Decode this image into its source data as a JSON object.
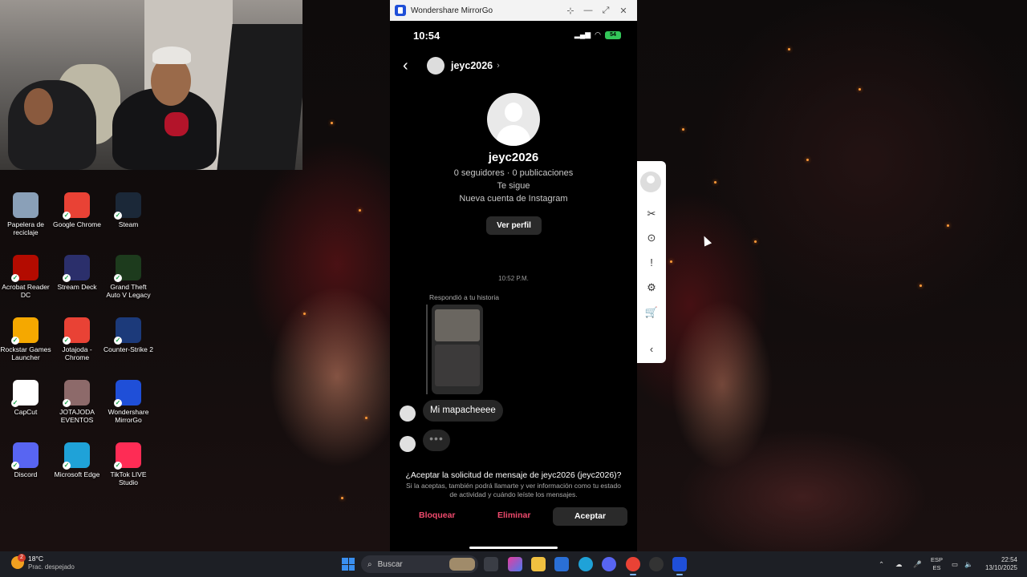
{
  "desktop": {
    "icons": [
      {
        "label": "Papelera de reciclaje",
        "icon": "recycle-bin-icon",
        "color": "#8aa0b8"
      },
      {
        "label": "Google Chrome",
        "icon": "chrome-icon",
        "color": "#e94235"
      },
      {
        "label": "Steam",
        "icon": "steam-icon",
        "color": "#1b2838"
      },
      {
        "label": "Acrobat Reader DC",
        "icon": "acrobat-icon",
        "color": "#b30b00"
      },
      {
        "label": "Stream Deck",
        "icon": "stream-deck-icon",
        "color": "#2b2f6b"
      },
      {
        "label": "Grand Theft Auto V Legacy",
        "icon": "gta-icon",
        "color": "#1d3b1d"
      },
      {
        "label": "Rockstar Games Launcher",
        "icon": "rockstar-icon",
        "color": "#f5a800"
      },
      {
        "label": "Jotajoda - Chrome",
        "icon": "chrome-icon",
        "color": "#e94235"
      },
      {
        "label": "Counter-Strike 2",
        "icon": "cs2-icon",
        "color": "#1c3a7a"
      },
      {
        "label": "CapCut",
        "icon": "capcut-icon",
        "color": "#ffffff"
      },
      {
        "label": "JOTAJODA EVENTOS",
        "icon": "folder-file-icon",
        "color": "#8d6a6a"
      },
      {
        "label": "Wondershare MirrorGo",
        "icon": "mirrorgo-icon",
        "color": "#1f4fd8"
      },
      {
        "label": "Discord",
        "icon": "discord-icon",
        "color": "#5865f2"
      },
      {
        "label": "Microsoft Edge",
        "icon": "edge-icon",
        "color": "#1fa2d8"
      },
      {
        "label": "TikTok LIVE Studio",
        "icon": "tiktok-icon",
        "color": "#fe2c55"
      }
    ]
  },
  "mirrorgo": {
    "title": "Wondershare MirrorGo",
    "window_buttons": {
      "pin": "⊹",
      "minimize": "—",
      "maximize": "⤢",
      "close": "✕"
    }
  },
  "phone": {
    "time": "10:54",
    "battery": "54",
    "header": {
      "back": "‹",
      "username": "jeyc2026",
      "chevron": "›"
    },
    "profile": {
      "name": "jeyc2026",
      "stats": "0 seguidores · 0 publicaciones",
      "follows_you": "Te sigue",
      "new_account": "Nueva cuenta de Instagram",
      "view_profile": "Ver perfil"
    },
    "chat": {
      "timestamp": "10:52 P.M.",
      "reply_label": "Respondió a tu historia",
      "message": "Mi mapacheeee",
      "typing": "•••"
    },
    "request": {
      "title": "¿Aceptar la solicitud de mensaje de jeyc2026 (jeyc2026)?",
      "subtitle": "Si la aceptas, también podrá llamarte y ver información como tu estado de actividad y cuándo leíste los mensajes.",
      "block": "Bloquear",
      "delete": "Eliminar",
      "accept": "Aceptar"
    }
  },
  "toolbar": {
    "items": [
      {
        "name": "scissors-icon",
        "glyph": "✂"
      },
      {
        "name": "record-icon",
        "glyph": "⊙"
      },
      {
        "name": "alert-icon",
        "glyph": "!"
      },
      {
        "name": "settings-icon",
        "glyph": "⚙"
      },
      {
        "name": "cart-icon",
        "glyph": "🛒"
      },
      {
        "name": "collapse-chevron-icon",
        "glyph": "‹"
      }
    ]
  },
  "taskbar": {
    "weather": {
      "temp": "18°C",
      "desc": "Prac. despejado",
      "badge": "2"
    },
    "search_placeholder": "Buscar",
    "lang_top": "ESP",
    "lang_bottom": "ES",
    "time": "22:54",
    "date": "13/10/2025"
  }
}
